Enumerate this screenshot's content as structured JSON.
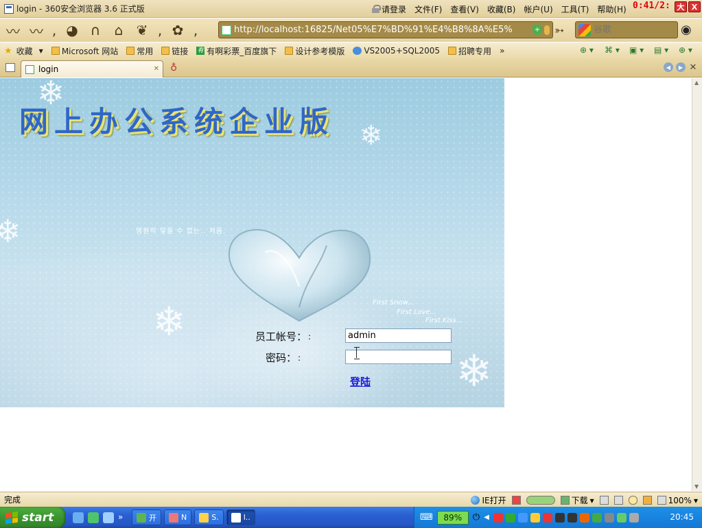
{
  "window": {
    "title": "login - 360安全浏览器 3.6 正式版",
    "login_link": "请登录",
    "menus": [
      "文件(F)",
      "查看(V)",
      "收藏(B)",
      "帐户(U)",
      "工具(T)",
      "帮助(H)"
    ],
    "clock": "0:41/2:",
    "controls": [
      "大",
      "X"
    ]
  },
  "toolbar": {
    "address": "http://localhost:16825/Net05%E7%BD%91%E4%B8%8A%E5%",
    "search_placeholder": "谷歌"
  },
  "favorites": {
    "label": "收藏",
    "items": [
      {
        "label": "Microsoft 网站",
        "icon": "folder-icon"
      },
      {
        "label": "常用",
        "icon": "folder-icon"
      },
      {
        "label": "链接",
        "icon": "folder-icon"
      },
      {
        "label": "有啊彩票_百度旗下",
        "icon": "site-logo-icon"
      },
      {
        "label": "设计参考模版",
        "icon": "folder-icon"
      },
      {
        "label": "VS2005+SQL2005",
        "icon": "ie-icon"
      },
      {
        "label": "招聘专用",
        "icon": "folder-icon"
      }
    ],
    "more": "»"
  },
  "tabs": [
    {
      "label": "login",
      "active": true
    }
  ],
  "page": {
    "heading": "网上办公系统企业版",
    "korean_text": "영원히 잊을 수 없는.. 처음.",
    "captions": [
      "First Snow...",
      "First Love...",
      "First Kiss..."
    ],
    "form": {
      "username_label": "员工帐号：",
      "username_value": "admin",
      "password_label": "密码：",
      "password_value": "",
      "login_button": "登陆"
    }
  },
  "statusbar": {
    "status": "完成",
    "ie_open": "IE打开",
    "download": "下载",
    "zoom": "100%"
  },
  "taskbar": {
    "start": "start",
    "more": "»",
    "tasks": [
      {
        "label": "开",
        "active": false
      },
      {
        "label": "N",
        "active": false
      },
      {
        "label": "S.",
        "active": false
      },
      {
        "label": "l..",
        "active": true
      }
    ],
    "battery": "89%",
    "time": "20:45"
  },
  "colors": {
    "heading": "#2f67c8",
    "heading_shadow": "#e8e27a",
    "link": "#1a1ad6",
    "taskbar": "#2456c6",
    "start": "#3a9430"
  }
}
